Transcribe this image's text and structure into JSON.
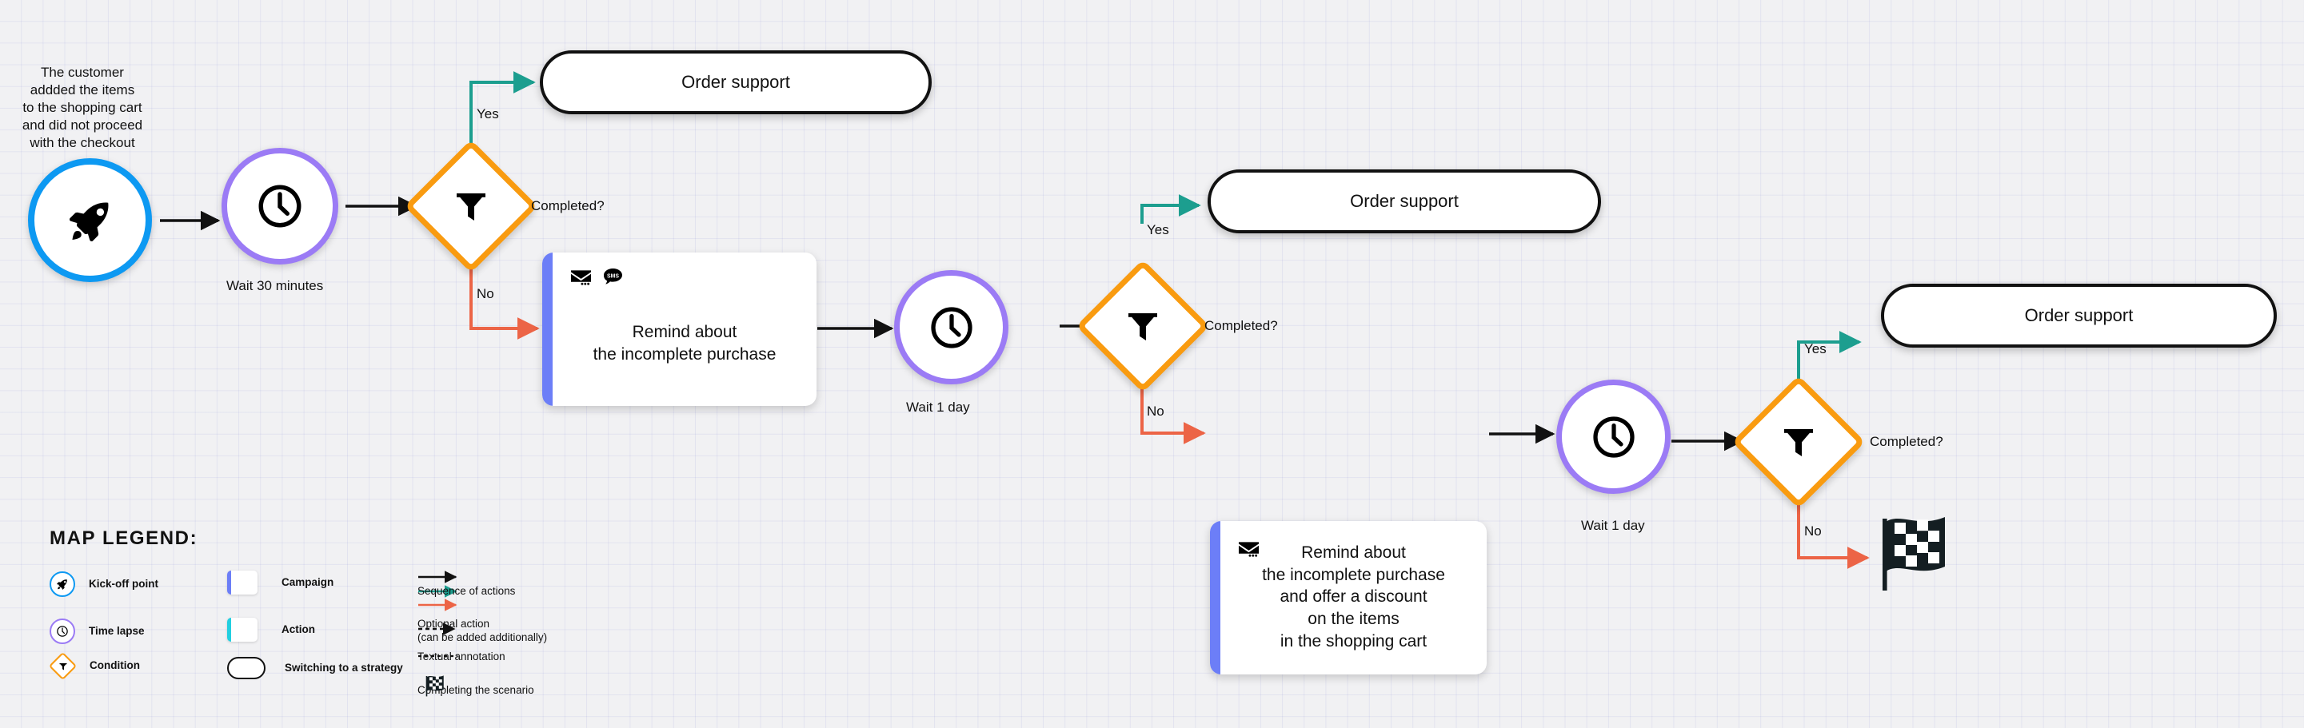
{
  "diagram": {
    "title_note": "The customer\naddded the items\nto the shopping cart\nand did not proceed\nwith the checkout",
    "colors": {
      "kickoff_blue": "#0d99f2",
      "time_purple": "#9b7bf5",
      "condition_orange": "#f99b10",
      "campaign_stripe": "#6c7ef7",
      "action_stripe": "#22cfe0",
      "yes_arrow": "#1c9e8f",
      "no_arrow": "#ec6446",
      "sequence_arrow": "#111111",
      "canvas": "#f1f1f3"
    },
    "nodes": {
      "kickoff": {
        "icon": "rocket-icon"
      },
      "wait1": {
        "icon": "clock-icon",
        "label": "Wait 30 minutes"
      },
      "cond1": {
        "icon": "funnel-icon",
        "label": "Completed?",
        "yes": "Yes",
        "no": "No"
      },
      "support1": {
        "label": "Order support"
      },
      "campaign1": {
        "icons": [
          "email-icon",
          "sms-icon"
        ],
        "text": "Remind about\nthe incomplete purchase"
      },
      "wait2": {
        "icon": "clock-icon",
        "label": "Wait 1 day"
      },
      "cond2": {
        "icon": "funnel-icon",
        "label": "Completed?",
        "yes": "Yes",
        "no": "No"
      },
      "support2": {
        "label": "Order support"
      },
      "campaign2": {
        "icons": [
          "email-icon"
        ],
        "text": "Remind about\nthe incomplete purchase\nand offer a discount\non the items\nin the shopping cart"
      },
      "wait3": {
        "icon": "clock-icon",
        "label": "Wait 1 day"
      },
      "cond3": {
        "icon": "funnel-icon",
        "label": "Completed?",
        "yes": "Yes",
        "no": "No"
      },
      "support3": {
        "label": "Order support"
      },
      "finish": {
        "icon": "checkered-flag-icon"
      }
    }
  },
  "legend": {
    "title": "MAP LEGEND:",
    "items": [
      {
        "name": "kick-off-point",
        "label": "Kick-off point",
        "icon": "rocket-icon"
      },
      {
        "name": "time-lapse",
        "label": "Time lapse",
        "icon": "clock-icon"
      },
      {
        "name": "condition",
        "label": "Condition",
        "icon": "funnel-icon"
      },
      {
        "name": "campaign",
        "label": "Campaign",
        "swatch": "#6c7ef7"
      },
      {
        "name": "action",
        "label": "Action",
        "swatch": "#22cfe0"
      },
      {
        "name": "switching-to-a-strategy",
        "label": "Switching to a strategy"
      },
      {
        "name": "sequence-of-actions",
        "label": "Sequence of actions"
      },
      {
        "name": "optional-action",
        "label": "Optional action\n(can be added additionally)"
      },
      {
        "name": "textual-annotation",
        "label": "Textual annotation"
      },
      {
        "name": "completing-the-scenario",
        "label": "Completing the scenario"
      }
    ]
  }
}
